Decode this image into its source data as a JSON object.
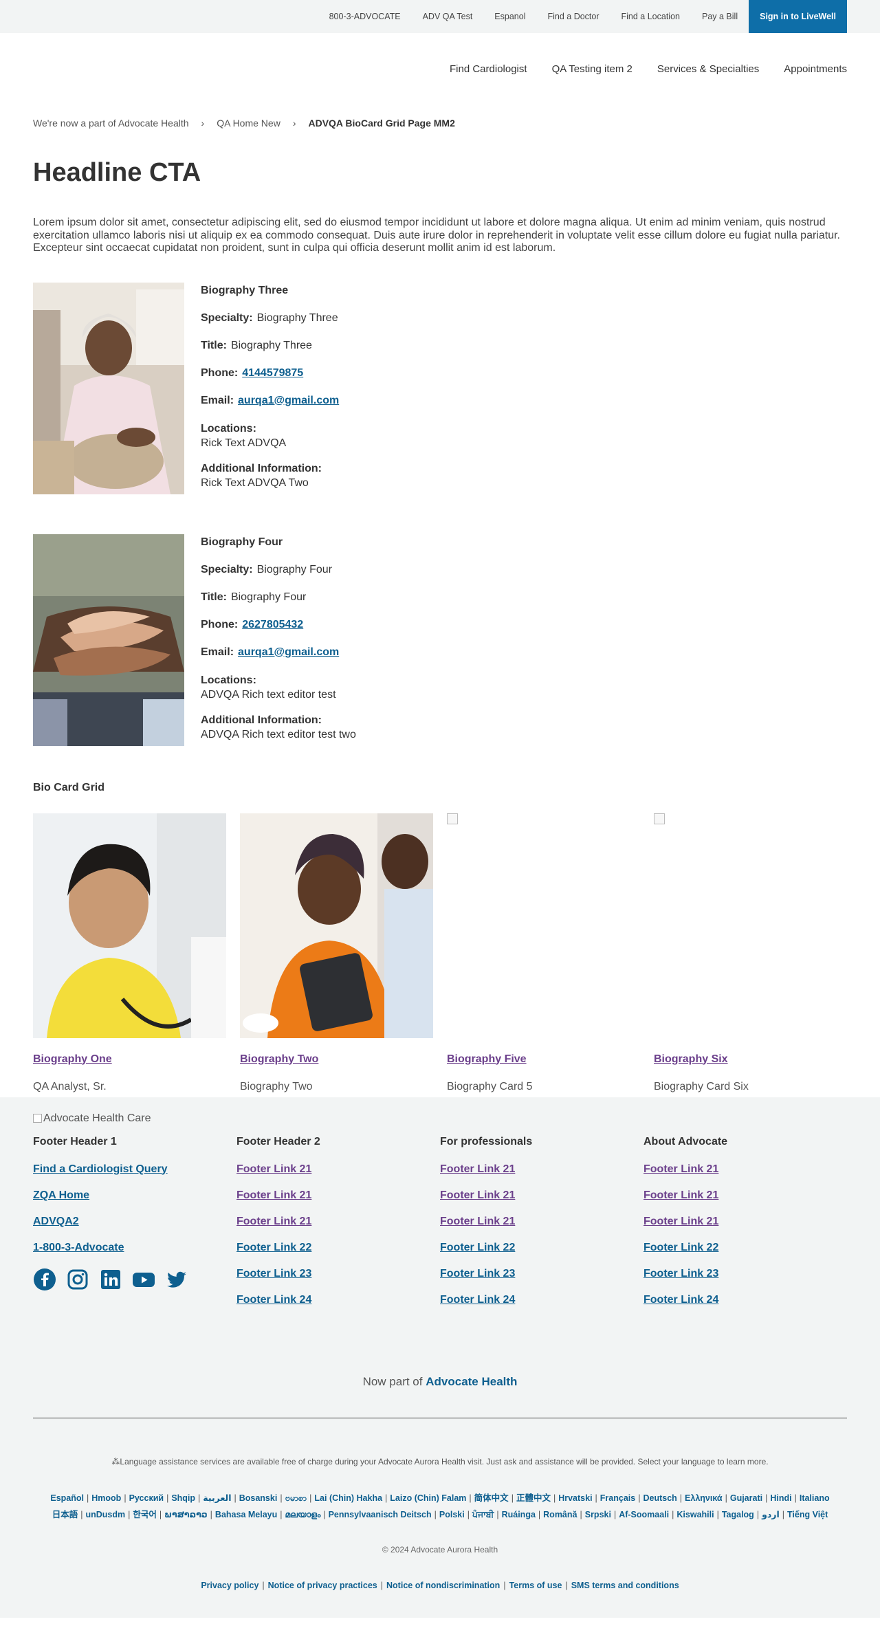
{
  "utility": {
    "links": [
      "800-3-ADVOCATE",
      "ADV QA Test",
      "Espanol",
      "Find a Doctor",
      "Find a Location",
      "Pay a Bill"
    ],
    "signin": "Sign in to LiveWell"
  },
  "nav": {
    "items": [
      "Find Cardiologist",
      "QA Testing item 2",
      "Services & Specialties",
      "Appointments"
    ]
  },
  "breadcrumb": {
    "items": [
      "We're now a part of Advocate Health",
      "QA Home New"
    ],
    "current": "ADVQA BioCard Grid Page MM2"
  },
  "page": {
    "title": "Headline CTA",
    "intro": "Lorem ipsum dolor sit amet, consectetur adipiscing elit, sed do eiusmod tempor incididunt ut labore et dolore magna aliqua. Ut enim ad minim veniam, quis nostrud exercitation ullamco laboris nisi ut aliquip ex ea commodo consequat. Duis aute irure dolor in reprehenderit in voluptate velit esse cillum dolore eu fugiat nulla pariatur. Excepteur sint occaecat cupidatat non proident, sunt in culpa qui officia deserunt mollit anim id est laborum."
  },
  "labels": {
    "specialty": "Specialty:",
    "title": "Title:",
    "phone": "Phone:",
    "email": "Email:",
    "locations": "Locations:",
    "additional": "Additional Information:"
  },
  "bios": [
    {
      "name": "Biography Three",
      "specialty": "Biography Three",
      "title": "Biography Three",
      "phone": "4144579875",
      "email": "aurqa1@gmail.com",
      "locations": "Rick Text ADVQA",
      "additional": "Rick Text ADVQA Two"
    },
    {
      "name": "Biography Four",
      "specialty": "Biography Four",
      "title": "Biography Four",
      "phone": "2627805432",
      "email": "aurqa1@gmail.com",
      "locations": "ADVQA Rich text editor test",
      "additional": "ADVQA Rich text editor test two"
    }
  ],
  "grid": {
    "heading": "Bio Card Grid",
    "cards": [
      {
        "name": "Biography One",
        "title": "QA Analyst, Sr."
      },
      {
        "name": "Biography Two",
        "title": "Biography Two"
      },
      {
        "name": "Biography Five",
        "title": "Biography Card 5"
      },
      {
        "name": "Biography Six",
        "title": "Biography Card Six"
      }
    ]
  },
  "footer": {
    "logo_alt": "Advocate Health Care",
    "columns": [
      {
        "header": "Footer Header 1",
        "links": [
          "Find a Cardiologist Query",
          "ZQA Home",
          "ADVQA2",
          "1-800-3-Advocate"
        ]
      },
      {
        "header": "Footer Header 2",
        "links": [
          "Footer Link 21",
          "Footer Link 21",
          "Footer Link 21",
          "Footer Link 22",
          "Footer Link 23",
          "Footer Link 24"
        ]
      },
      {
        "header": "For professionals",
        "links": [
          "Footer Link 21",
          "Footer Link 21",
          "Footer Link 21",
          "Footer Link 22",
          "Footer Link 23",
          "Footer Link 24"
        ]
      },
      {
        "header": "About Advocate",
        "links": [
          "Footer Link 21",
          "Footer Link 21",
          "Footer Link 21",
          "Footer Link 22",
          "Footer Link 23",
          "Footer Link 24"
        ]
      }
    ],
    "social": [
      "facebook-icon",
      "instagram-icon",
      "linkedin-icon",
      "youtube-icon",
      "twitter-icon"
    ],
    "nowpart_prefix": "Now part of",
    "nowpart_brand": "Advocate Health",
    "lang_note": "Language assistance services are available free of charge during your Advocate Aurora Health visit. Just ask and assistance will be provided. Select your language to learn more.",
    "languages_row1": [
      "Español",
      "Hmoob",
      "Русский",
      "Shqip",
      "العربية",
      "Bosanski",
      "ဗမာစာ",
      "Lai (Chin) Hakha",
      "Laizo (Chin) Falam",
      "简体中文",
      "正體中文",
      "Hrvatski",
      "Français",
      "Deutsch",
      "Ελληνικά",
      "Gujarati",
      "Hindi",
      "Italiano"
    ],
    "languages_row2": [
      "日本語",
      "unDusdm",
      "한국어",
      "ພາສາລາວ",
      "Bahasa Melayu",
      "മലയാളം",
      "Pennsylvaanisch Deitsch",
      "Polski",
      "ਪੰਜਾਬੀ",
      "Ruáinga",
      "Română",
      "Srpski",
      "Af-Soomaali",
      "Kiswahili",
      "Tagalog",
      "اردو",
      "Tiếng Việt"
    ],
    "copyright": "© 2024 Advocate Aurora Health",
    "legal": [
      "Privacy policy",
      "Notice of privacy practices",
      "Notice of nondiscrimination",
      "Terms of use",
      "SMS terms and conditions"
    ]
  },
  "colors": {
    "brand_blue": "#0e6ea8",
    "link_blue": "#0e5f8f",
    "visited_purple": "#6b3f8b",
    "footer_bg": "#f2f4f4"
  }
}
